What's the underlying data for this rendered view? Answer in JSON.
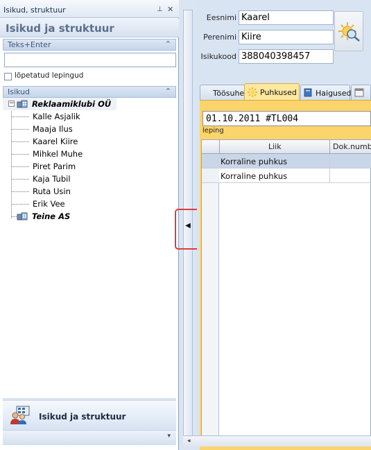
{
  "left_panel": {
    "window_title": "Isikud, struktuur",
    "header": "Isikud ja struktuur",
    "search_group_label": "Teks+Enter",
    "search_value": "",
    "checkbox_label": "lõpetatud lepingud",
    "persons_group_label": "Isikud",
    "tree": {
      "org1": "Reklaamiklubi OÜ",
      "people": [
        "Kalle Asjalik",
        "Maaja  Ilus",
        "Kaarel  Kiire",
        "Mihkel  Muhe",
        "Piret Parim",
        "Kaja Tubil",
        "Ruta  Usin",
        "Erik Vee"
      ],
      "org2": "Teine AS"
    },
    "nav_button_label": "Isikud ja struktuur"
  },
  "person": {
    "first_name_label": "Eesnimi",
    "first_name": "Kaarel",
    "last_name_label": "Perenimi",
    "last_name": "Kiire",
    "id_code_label": "Isikukood",
    "id_code": "388040398457"
  },
  "tabs": [
    "Töösuhe",
    "Puhkused",
    "Haigused"
  ],
  "active_tab": "Puhkused",
  "contract": {
    "value": "01.10.2011 #TL004",
    "caption": "leping"
  },
  "grid": {
    "columns": [
      "Liik",
      "Dok.numb"
    ],
    "rows": [
      [
        "Korraline puhkus",
        ""
      ],
      [
        "Korraline puhkus",
        ""
      ]
    ]
  },
  "colors": {
    "active_tab": "#fbd46c",
    "panel_bg": "#d9e4f2",
    "highlight": "#e03a3a"
  }
}
